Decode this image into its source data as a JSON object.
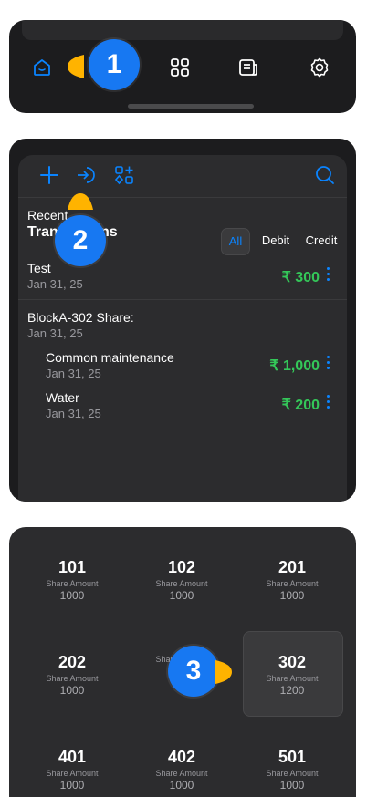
{
  "panel1": {
    "tabs": [
      {
        "icon": "home-icon",
        "active": true
      },
      {
        "icon": "grid-icon",
        "active": false
      },
      {
        "icon": "document-icon",
        "active": false
      },
      {
        "icon": "gear-icon",
        "active": false
      }
    ],
    "callout": "1"
  },
  "panel2": {
    "toolbar": {
      "icons": [
        "plus-icon",
        "import-icon",
        "apps-add-icon",
        "search-icon"
      ]
    },
    "callout": "2",
    "header": {
      "line1": "Recent",
      "line2": "Transactions"
    },
    "segments": [
      "All",
      "Debit",
      "Credit"
    ],
    "transactions": [
      {
        "title": "Test",
        "date": "Jan 31, 25",
        "amount": "₹ 300"
      },
      {
        "title": "BlockA-302 Share:",
        "date": "Jan 31, 25",
        "amount": ""
      },
      {
        "title": "Common maintenance",
        "date": "Jan 31, 25",
        "amount": "₹ 1,000"
      },
      {
        "title": "Water",
        "date": "Jan 31, 25",
        "amount": "₹ 200"
      }
    ]
  },
  "panel3": {
    "callout": "3",
    "label": "Share Amount",
    "units": [
      {
        "num": "101",
        "amount": "1000"
      },
      {
        "num": "102",
        "amount": "1000"
      },
      {
        "num": "201",
        "amount": "1000"
      },
      {
        "num": "202",
        "amount": "1000"
      },
      {
        "num": "",
        "amount": ""
      },
      {
        "num": "302",
        "amount": "1200"
      },
      {
        "num": "401",
        "amount": "1000"
      },
      {
        "num": "402",
        "amount": "1000"
      },
      {
        "num": "501",
        "amount": "1000"
      }
    ]
  },
  "colors": {
    "accent": "#0a84ff",
    "callout": "#1778f2",
    "pointer": "#ffb300",
    "positive": "#34c759"
  }
}
